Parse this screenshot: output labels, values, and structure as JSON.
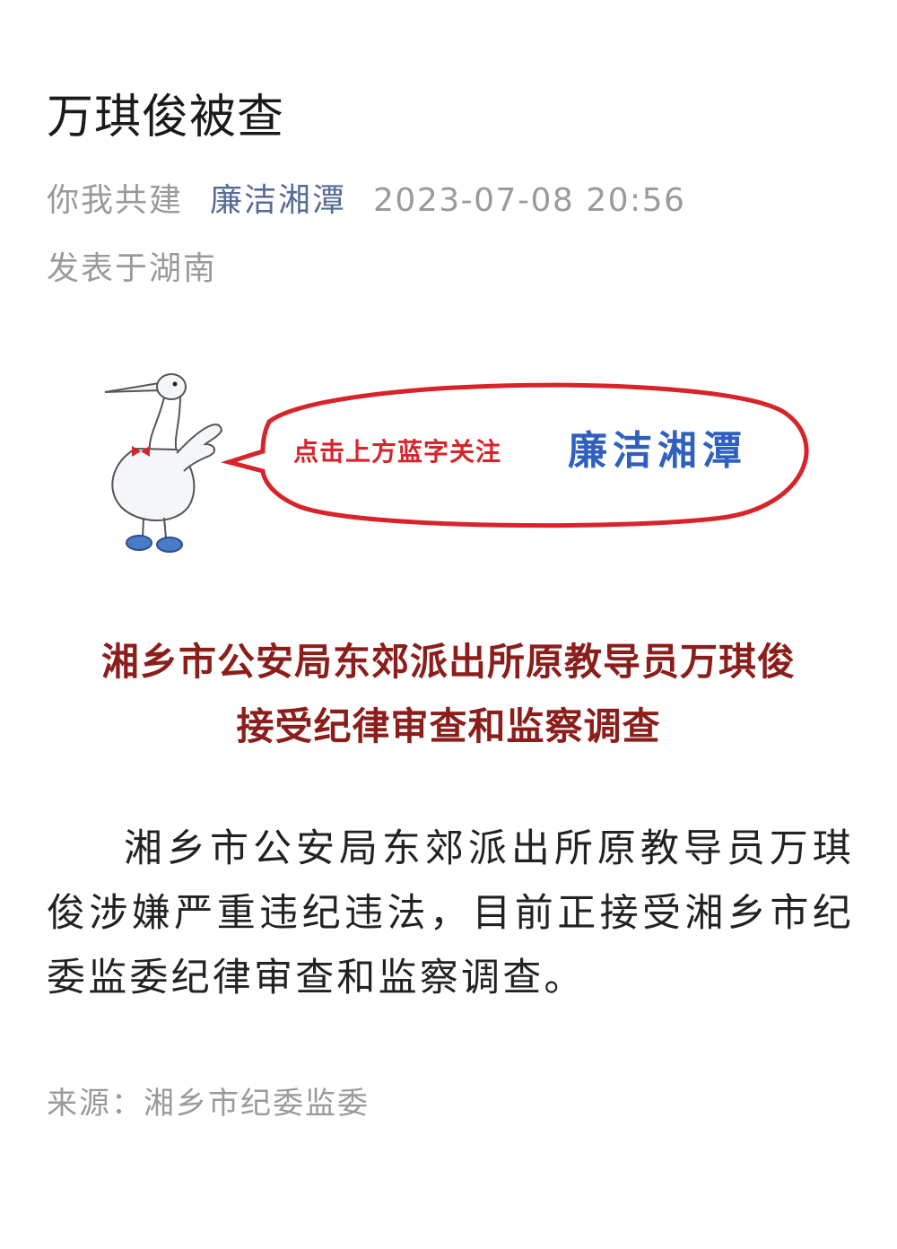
{
  "article": {
    "title": "万琪俊被查",
    "meta": {
      "author": "你我共建",
      "account": "廉洁湘潭",
      "datetime": "2023-07-08 20:56",
      "location": "发表于湖南"
    }
  },
  "banner": {
    "follow_prompt": "点击上方蓝字关注",
    "account_name": "廉洁湘潭",
    "mascot": "crane-mascot-icon",
    "bubble_color": "#d8232a",
    "account_color": "#2f5fbf"
  },
  "headline": {
    "line1": "湘乡市公安局东郊派出所原教导员万琪俊",
    "line2": "接受纪律审查和监察调查",
    "color": "#8b1e1b"
  },
  "body": {
    "paragraph": "湘乡市公安局东郊派出所原教导员万琪俊涉嫌严重违纪违法，目前正接受湘乡市纪委监委纪律审查和监察调查。"
  },
  "footer": {
    "source": "来源：湘乡市纪委监委"
  }
}
